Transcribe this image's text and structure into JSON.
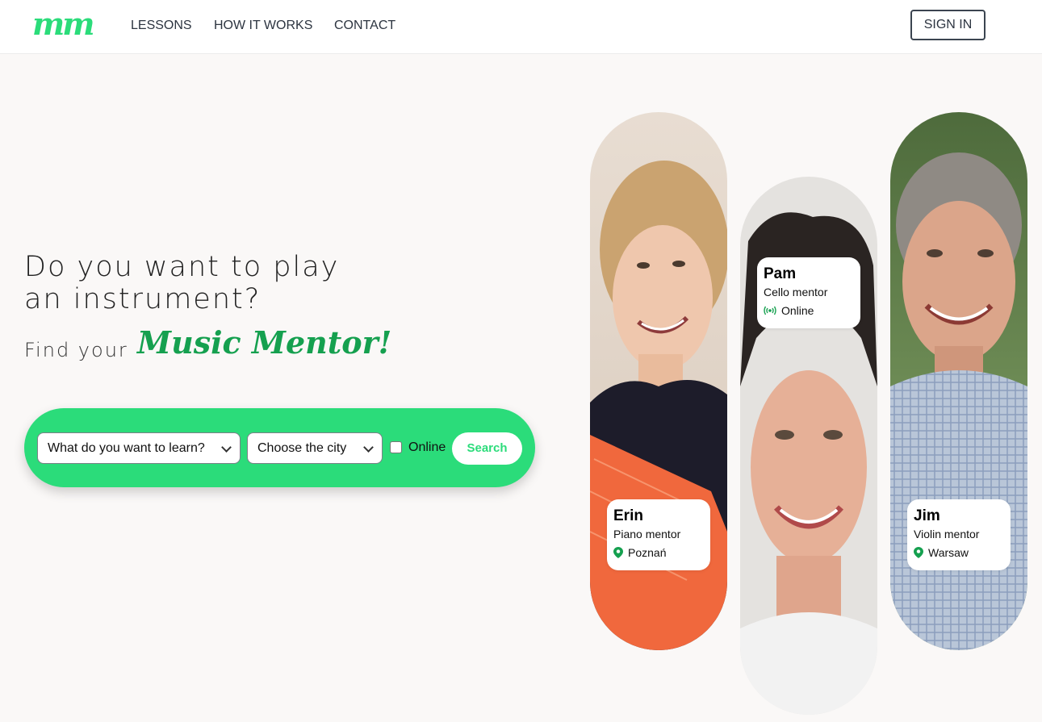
{
  "nav": {
    "logo": "mm",
    "links": [
      "LESSONS",
      "HOW IT WORKS",
      "CONTACT"
    ],
    "sign_in": "SIGN IN"
  },
  "hero": {
    "headline_line1": "Do you want to play",
    "headline_line2": "an instrument?",
    "find_prefix": "Find your",
    "find_highlight": "Music Mentor!"
  },
  "search": {
    "instrument_select": "What do you want to learn?",
    "city_select": "Choose the city",
    "online_label": "Online",
    "online_checked": false,
    "button": "Search"
  },
  "mentors": [
    {
      "name": "Erin",
      "role": "Piano mentor",
      "meta": "Poznań",
      "meta_icon": "location-pin-icon"
    },
    {
      "name": "Pam",
      "role": "Cello mentor",
      "meta": "Online",
      "meta_icon": "broadcast-icon"
    },
    {
      "name": "Jim",
      "role": "Violin mentor",
      "meta": "Warsaw",
      "meta_icon": "location-pin-icon"
    }
  ],
  "colors": {
    "accent": "#2bdc7a",
    "accent_dark": "#15a04f",
    "background": "#faf8f7"
  }
}
